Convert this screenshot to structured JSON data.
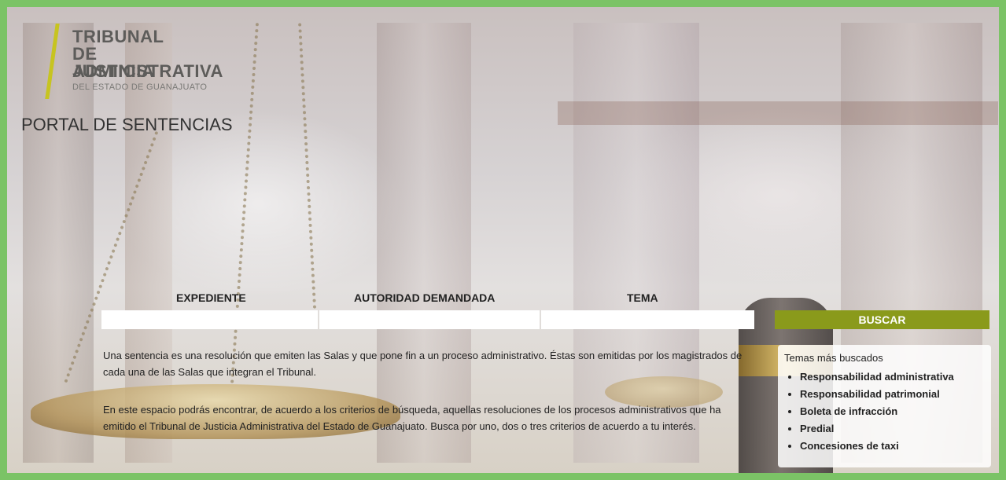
{
  "brand": {
    "logo_line1": "TRIBUNAL",
    "logo_line2": "DE JUSTICIA",
    "logo_line3": "ADMINISTRATIVA",
    "logo_subtitle": "DEL ESTADO DE GUANAJUATO",
    "accent_color": "#c7c420"
  },
  "page": {
    "title": "PORTAL DE SENTENCIAS"
  },
  "search": {
    "expediente_label": "EXPEDIENTE",
    "expediente_value": "",
    "autoridad_label": "AUTORIDAD DEMANDADA",
    "autoridad_value": "",
    "tema_label": "TEMA",
    "tema_value": "",
    "button_label": "BUSCAR",
    "button_color": "#8a9a1b"
  },
  "description": {
    "paragraph1": "Una sentencia es una resolución que emiten las Salas y que pone fin a un proceso administrativo. Éstas son emitidas por los magistrados de cada una de las Salas que integran el Tribunal.",
    "paragraph2": "En este espacio podrás encontrar, de acuerdo a los criterios de búsqueda, aquellas resoluciones de los procesos administrativos que ha emitido el Tribunal de Justicia Administrativa del Estado de Guanajuato. Busca por uno, dos o tres criterios de acuerdo a tu interés."
  },
  "topics": {
    "title": "Temas más buscados",
    "items": [
      "Responsabilidad administrativa",
      "Responsabilidad patrimonial",
      "Boleta de infracción",
      "Predial",
      "Concesiones de taxi"
    ]
  },
  "frame_color": "#7bc366"
}
